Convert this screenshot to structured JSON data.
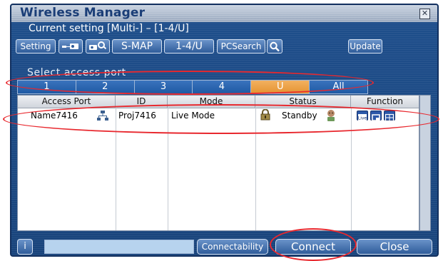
{
  "window": {
    "title": "Wireless Manager",
    "close_glyph": "✕"
  },
  "current_setting": {
    "label": "Current",
    "text": "setting [Multi-] – [1-4/U]"
  },
  "toolbar": {
    "setting_label": "Setting",
    "smap_label": "S-MAP",
    "layout_label": "1-4/U",
    "pcsearch_label": "PCSearch",
    "update_label": "Update"
  },
  "select_port": {
    "label": "Select access port",
    "tabs": [
      "1",
      "2",
      "3",
      "4",
      "U",
      "All"
    ],
    "selected": "U"
  },
  "table": {
    "columns": [
      "Access Port",
      "ID",
      "Mode",
      "Status",
      "Function"
    ],
    "rows": [
      {
        "access_port": "Name7416",
        "id": "Proj7416",
        "mode": "Live Mode",
        "status": "Standby",
        "function_icons": [
          "live-icon",
          "window-icon",
          "split-icon"
        ]
      }
    ]
  },
  "footer": {
    "info_label": "i",
    "connectability_label": "Connectability",
    "connect_label": "Connect",
    "close_label": "Close"
  },
  "colors": {
    "window_bg": "#1f4f8c",
    "selected_tab": "#e59331",
    "annotation": "#e8282e"
  }
}
